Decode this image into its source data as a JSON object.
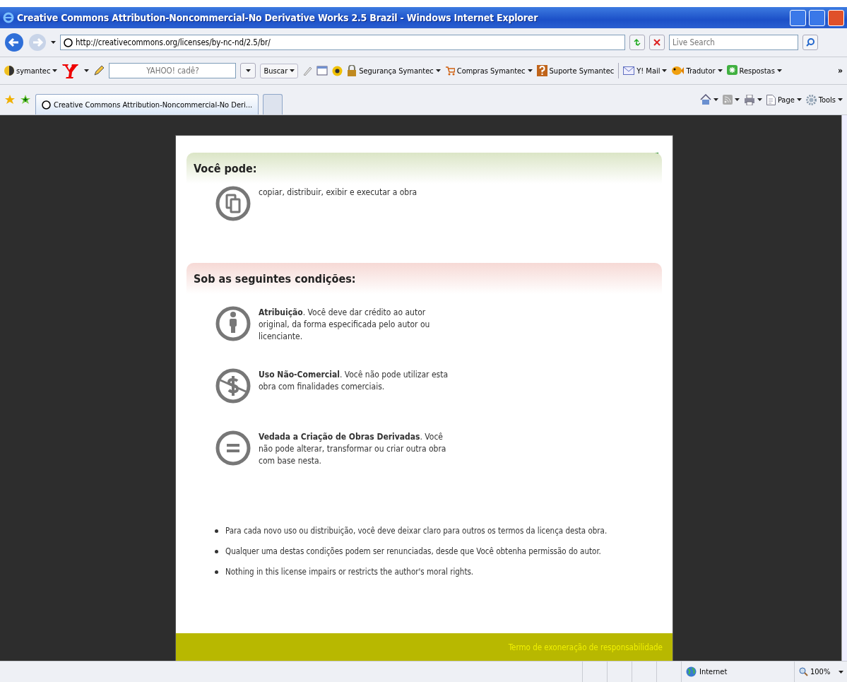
{
  "window": {
    "title": "Creative Commons Attribution-Noncommercial-No Derivative Works 2.5 Brazil - Windows Internet Explorer"
  },
  "address_bar": {
    "url": "http://creativecommons.org/licenses/by-nc-nd/2.5/br/",
    "search_placeholder": "Live Search"
  },
  "links_toolbar": {
    "symantec": "symantec",
    "search_field_placeholder": "YAHOO! cadê?",
    "search_button": "Buscar",
    "items": [
      {
        "kind": "lock",
        "label": "Segurança Symantec",
        "dropdown": true
      },
      {
        "kind": "cart",
        "label": "Compras Symantec",
        "dropdown": true
      },
      {
        "kind": "help",
        "label": "Suporte Symantec",
        "dropdown": false
      },
      {
        "kind": "mail",
        "label": "Y! Mail",
        "dropdown": true
      },
      {
        "kind": "fish",
        "label": "Tradutor",
        "dropdown": true
      },
      {
        "kind": "answers",
        "label": "Respostas",
        "dropdown": true
      }
    ],
    "overflow": "»"
  },
  "tabs": [
    {
      "label": "Creative Commons Attribution-Noncommercial-No Deri...",
      "selected": true
    }
  ],
  "command_bar": [
    {
      "kind": "home"
    },
    {
      "kind": "feed"
    },
    {
      "kind": "print"
    },
    {
      "kind": "page",
      "label": "Page"
    },
    {
      "kind": "tools",
      "label": "Tools"
    }
  ],
  "page": {
    "permissions": {
      "heading": "Você pode:",
      "items": [
        {
          "kind": "share",
          "text": "copiar, distribuir, exibir e executar a obra"
        }
      ]
    },
    "conditions": {
      "heading": "Sob as seguintes condições:",
      "items": [
        {
          "kind": "by",
          "text": "**Atribuição**. Você deve dar crédito ao autor original, da forma especificada pelo autor ou licenciante."
        },
        {
          "kind": "nc",
          "text": "**Uso Não-Comercial**. Você não pode utilizar esta obra com finalidades comerciais."
        },
        {
          "kind": "nd",
          "text": "**Vedada a Criação de Obras Derivadas**. Você não pode alterar, transformar ou criar outra obra com base nesta."
        }
      ]
    },
    "notes": [
      "Para cada novo uso ou distribuição, você deve deixar claro para outros os termos da licença desta obra.",
      "Qualquer uma destas condições podem ser renunciadas, desde que Você obtenha permissão do autor.",
      "Nothing in this license impairs or restricts the author's moral rights."
    ],
    "footer_link": "Termo de exoneração de responsabilidade"
  },
  "status_bar": {
    "zone": "Internet",
    "zoom": "100%"
  }
}
